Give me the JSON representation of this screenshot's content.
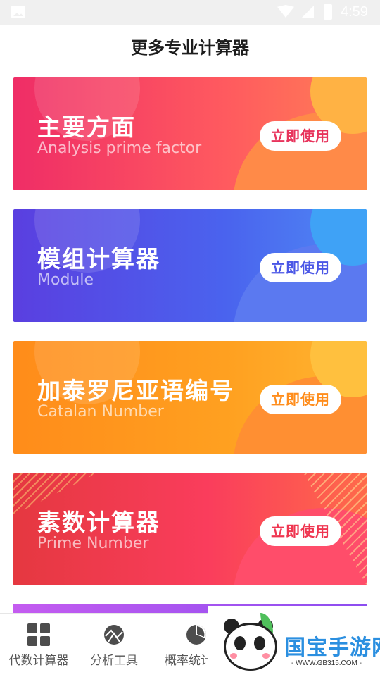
{
  "status_bar": {
    "time": "4:59",
    "icons": [
      "image-icon",
      "wifi-icon",
      "signal-icon",
      "battery-icon"
    ]
  },
  "header": {
    "title": "更多专业计算器"
  },
  "cards": [
    {
      "name": "主要方面",
      "subtitle": "Analysis prime factor",
      "button": "立即使用",
      "color": "#ef2d66"
    },
    {
      "name": "模组计算器",
      "subtitle": "Module",
      "button": "立即使用",
      "color": "#5a3fe0"
    },
    {
      "name": "加泰罗尼亚语编号",
      "subtitle": "Catalan  Number",
      "button": "立即使用",
      "color": "#ff8c1a"
    },
    {
      "name": "素数计算器",
      "subtitle": "Prime Number",
      "button": "立即使用",
      "color": "#e53840"
    }
  ],
  "bottom_nav": {
    "tabs": [
      {
        "label": "代数计算器",
        "icon": "calculator-grid-icon"
      },
      {
        "label": "分析工具",
        "icon": "analysis-globe-icon"
      },
      {
        "label": "概率统计",
        "icon": "pie-chart-icon"
      }
    ]
  },
  "watermark": {
    "brand": "国宝手游网",
    "url": "- WWW.GB315.COM -"
  }
}
